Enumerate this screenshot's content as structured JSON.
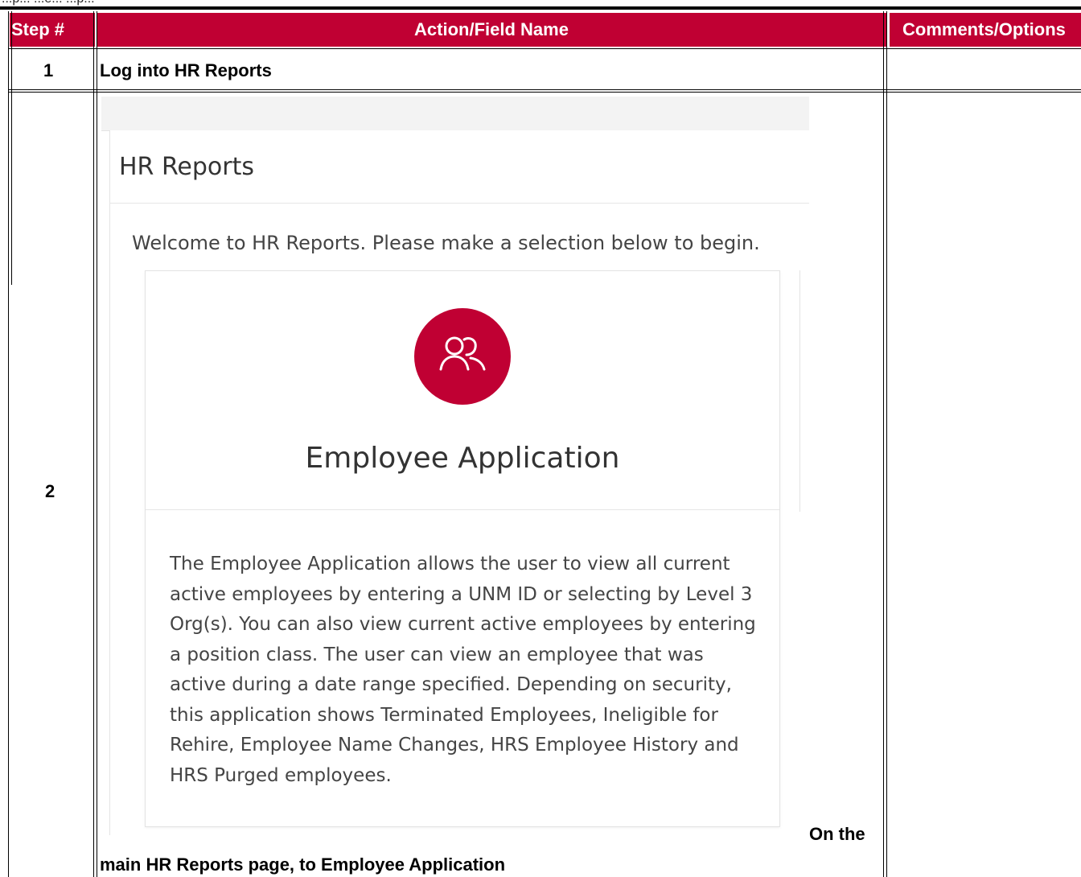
{
  "top_fragment": "...p... ...e... ...p...",
  "table": {
    "headers": {
      "step": "Step #",
      "action": "Action/Field Name",
      "comments": "Comments/Options"
    },
    "rows": [
      {
        "step": "1",
        "action": "Log into HR Reports",
        "comments": ""
      },
      {
        "step": "2",
        "action_line1": "On the",
        "action_line2": "main HR Reports page, to Employee Application",
        "comments": ""
      }
    ]
  },
  "screenshot": {
    "panel_title": "HR Reports",
    "welcome": "Welcome to HR Reports. Please make a selection below to begin.",
    "card": {
      "icon": "users-icon",
      "title": "Employee Application",
      "description": "The Employee Application allows the user to view all current active employees by entering a UNM ID or selecting by Level 3 Org(s). You can also view current active employees by entering a position class. The user can view an employee that was active during a date range specified. Depending on security, this application shows Terminated Employees, Ineligible for Rehire, Employee Name Changes, HRS Employee History and HRS Purged employees."
    }
  },
  "colors": {
    "header_bg": "#c00033",
    "icon_bg": "#c00033"
  }
}
